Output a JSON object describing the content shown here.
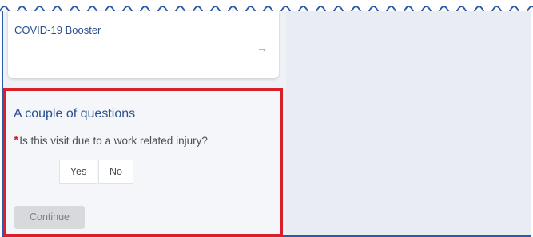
{
  "service_card": {
    "title": "COVID-19 Booster",
    "arrow_icon": "arrow-right-icon"
  },
  "questions": {
    "title": "A couple of questions",
    "required_marker": "*",
    "question": "Is this visit due to a work related injury?",
    "yes_label": "Yes",
    "no_label": "No",
    "continue_label": "Continue"
  },
  "colors": {
    "accent_blue": "#2a4f8f",
    "highlight_red": "#d9202a",
    "disabled_button": "#d7d9dc"
  }
}
